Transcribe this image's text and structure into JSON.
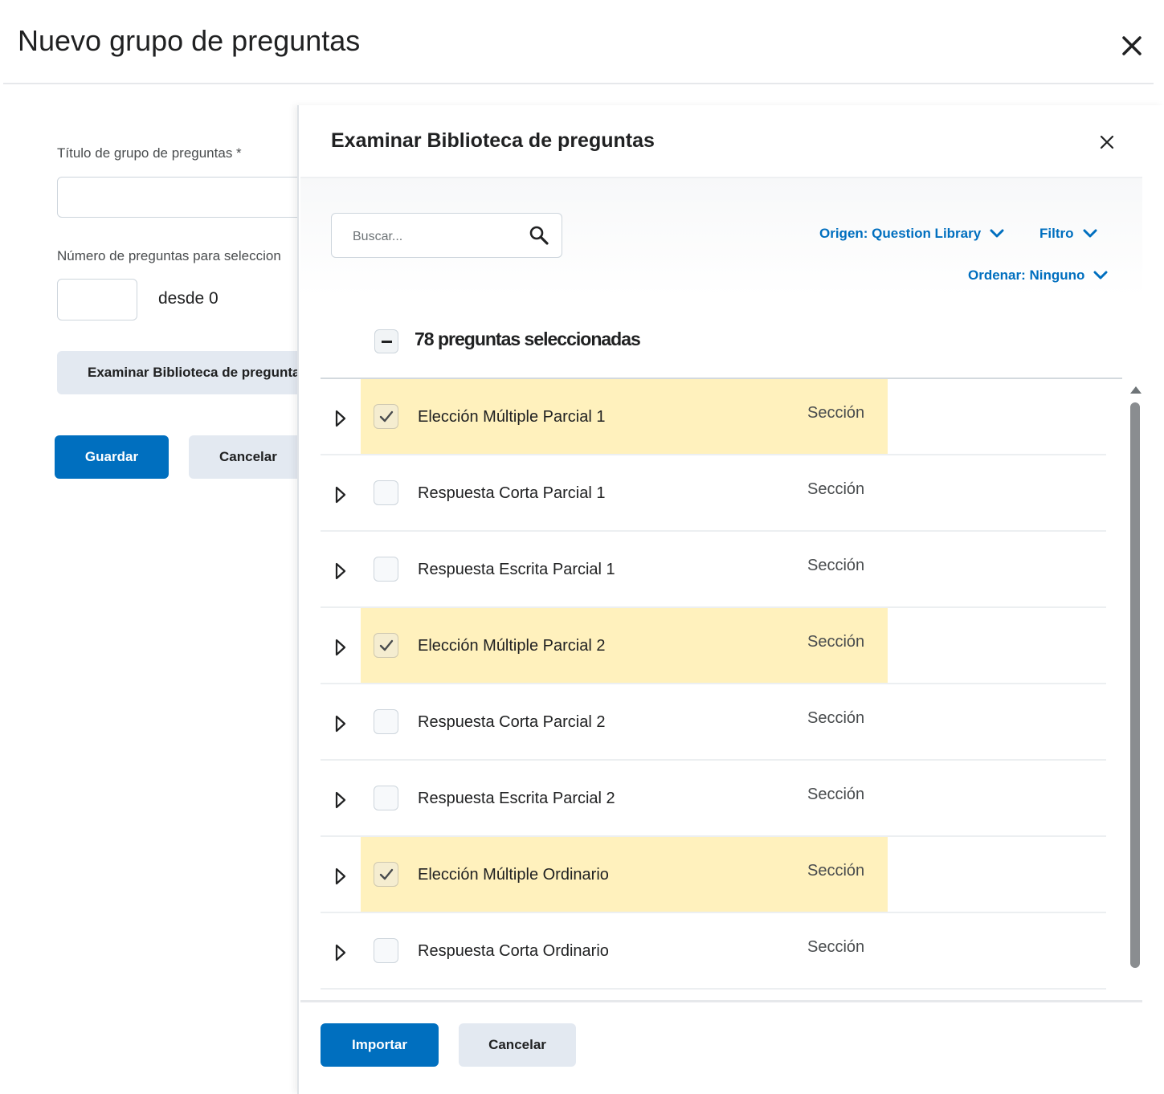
{
  "dialog": {
    "title": "Nuevo grupo de preguntas",
    "close_icon": "close-icon"
  },
  "form": {
    "title_label": "Título de grupo de preguntas *",
    "title_value": "",
    "number_label": "Número de preguntas para seleccion",
    "number_value": "",
    "from_text": "desde 0",
    "browse_button": "Examinar Biblioteca de pregunta",
    "save_button": "Guardar",
    "cancel_button": "Cancelar"
  },
  "panel": {
    "title": "Examinar Biblioteca de preguntas",
    "close_icon": "close-icon",
    "search_placeholder": "Buscar...",
    "search_icon": "search-icon",
    "source_dropdown": "Origen: Question Library",
    "filter_dropdown": "Filtro",
    "sort_dropdown": "Ordenar: Ninguno",
    "selected_count": "78 preguntas seleccionadas",
    "import_button": "Importar",
    "cancel_button": "Cancelar"
  },
  "questions": [
    {
      "name": "Elección Múltiple Parcial 1",
      "type": "Sección",
      "checked": true
    },
    {
      "name": "Respuesta Corta Parcial 1",
      "type": "Sección",
      "checked": false
    },
    {
      "name": "Respuesta Escrita Parcial 1",
      "type": "Sección",
      "checked": false
    },
    {
      "name": "Elección Múltiple Parcial 2",
      "type": "Sección",
      "checked": true
    },
    {
      "name": "Respuesta Corta Parcial 2",
      "type": "Sección",
      "checked": false
    },
    {
      "name": "Respuesta Escrita Parcial 2",
      "type": "Sección",
      "checked": false
    },
    {
      "name": "Elección Múltiple Ordinario",
      "type": "Sección",
      "checked": true
    },
    {
      "name": "Respuesta Corta Ordinario",
      "type": "Sección",
      "checked": false
    }
  ],
  "colors": {
    "primary": "#006fbf",
    "highlight": "#fff1bd",
    "secondary_button": "#e3e9f1"
  }
}
